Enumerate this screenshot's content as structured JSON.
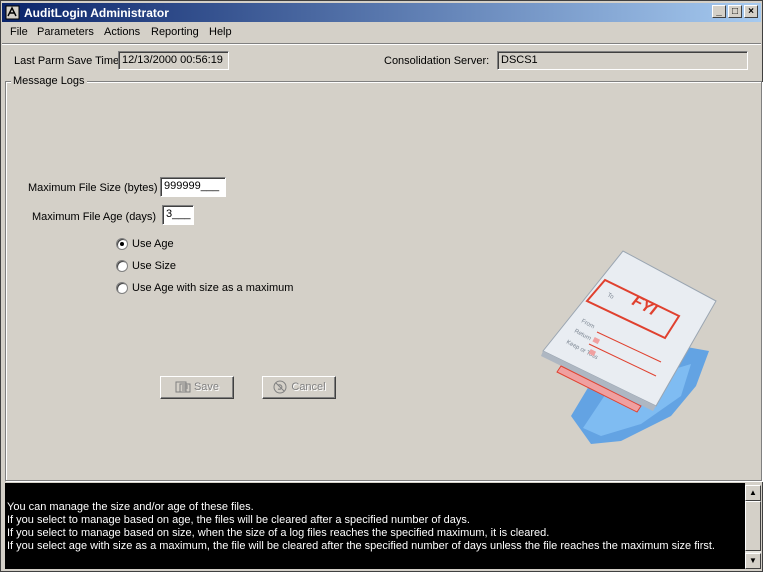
{
  "window": {
    "title": "AuditLogin Administrator"
  },
  "caption_buttons": {
    "minimize": "_",
    "maximize": "□",
    "close": "×"
  },
  "menu": [
    "File",
    "Parameters",
    "Actions",
    "Reporting",
    "Help"
  ],
  "header": {
    "last_parm_label": "Last Parm Save Time",
    "last_parm_value": "12/13/2000 00:56:19",
    "server_label": "Consolidation Server:",
    "server_value": "DSCS1"
  },
  "group": {
    "title": "Message Logs"
  },
  "form": {
    "max_size_label": "Maximum File Size (bytes)",
    "max_size_value": "999999___",
    "max_age_label": "Maximum File Age (days)",
    "max_age_value": "3___"
  },
  "radios": [
    {
      "label": "Use Age",
      "checked": true
    },
    {
      "label": "Use Size",
      "checked": false
    },
    {
      "label": "Use Age with size as a maximum",
      "checked": false
    }
  ],
  "buttons": {
    "save": "Save",
    "cancel": "Cancel"
  },
  "card": {
    "fyi": "FYI",
    "to": "To",
    "from": "From",
    "return": "Return",
    "keep_or_toss": "Keep or Toss"
  },
  "info": {
    "lines": [
      "You can manage the size and/or age of these files.",
      "If you select to manage based on age, the files will be cleared after a specified number of days.",
      "If you select to manage based on size, when the size of a log files reaches the specified maximum, it is cleared.",
      "If you select age with size as a maximum, the file will be cleared after the specified number of days unless the file reaches the maximum size first."
    ]
  },
  "icons": {
    "app": "app-icon",
    "save": "save-icon",
    "cancel": "cancel-icon"
  },
  "colors": {
    "title_start": "#0a246a",
    "title_end": "#a6caf0",
    "face": "#d4d0c8",
    "info_bg": "#000000",
    "fyi_red": "#e0412f"
  }
}
